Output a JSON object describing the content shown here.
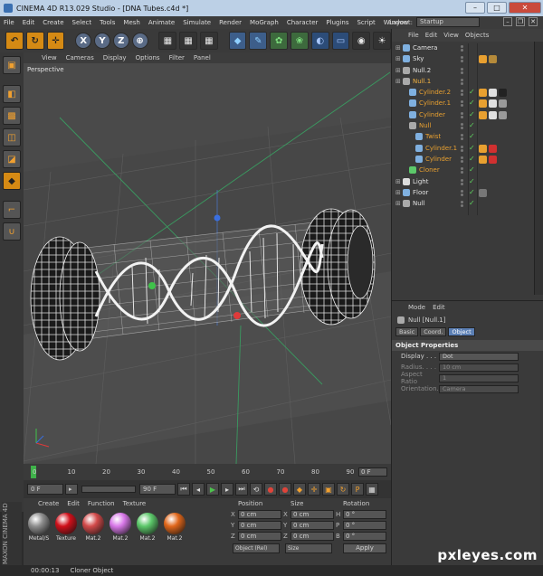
{
  "window": {
    "title": "CINEMA 4D R13.029 Studio - [DNA Tubes.c4d *]"
  },
  "menubar": [
    "File",
    "Edit",
    "Create",
    "Select",
    "Tools",
    "Mesh",
    "Animate",
    "Simulate",
    "Render",
    "MoGraph",
    "Character",
    "Plugins",
    "Script",
    "Window",
    "Help"
  ],
  "layout": {
    "label": "Layout:",
    "value": "Startup"
  },
  "viewport": {
    "menu": [
      "View",
      "Cameras",
      "Display",
      "Options",
      "Filter",
      "Panel"
    ],
    "label": "Perspective"
  },
  "timeline": {
    "ticks": [
      "0",
      "10",
      "20",
      "30",
      "40",
      "50",
      "60",
      "70",
      "80",
      "90"
    ],
    "frame_field": "0 F"
  },
  "transport": {
    "start": "0 F",
    "end": "90 F"
  },
  "materials": {
    "menu": [
      "Create",
      "Edit",
      "Function",
      "Texture"
    ],
    "items": [
      {
        "name": "Metal/S",
        "color": "#8e8e8e"
      },
      {
        "name": "Texture",
        "color": "#d0101a"
      },
      {
        "name": "Mat.2",
        "color": "#d24a4a"
      },
      {
        "name": "Mat.2",
        "color": "#d878e8"
      },
      {
        "name": "Mat.2",
        "color": "#5cc86a"
      },
      {
        "name": "Mat.2",
        "color": "#e0661a"
      }
    ],
    "brand": "MAXON CINEMA 4D"
  },
  "coords": {
    "headers": [
      "Position",
      "Size",
      "Rotation"
    ],
    "rows": [
      {
        "p_axis": "X",
        "p_val": "0 cm",
        "s_axis": "X",
        "s_val": "0 cm",
        "r_axis": "H",
        "r_val": "0 °"
      },
      {
        "p_axis": "Y",
        "p_val": "0 cm",
        "s_axis": "Y",
        "s_val": "0 cm",
        "r_axis": "P",
        "r_val": "0 °"
      },
      {
        "p_axis": "Z",
        "p_val": "0 cm",
        "s_axis": "Z",
        "s_val": "0 cm",
        "r_axis": "B",
        "r_val": "0 °"
      }
    ],
    "mode": "Object (Rel)",
    "size_mode": "Size",
    "apply": "Apply"
  },
  "status": {
    "time": "00:00:13",
    "message": "Cloner Object"
  },
  "object_manager": {
    "menu": [
      "File",
      "Edit",
      "View",
      "Objects"
    ],
    "items": [
      {
        "name": "Camera",
        "indent": 0,
        "color": "#e0e0e0",
        "icon": "#7fb0e0"
      },
      {
        "name": "Sky",
        "indent": 0,
        "color": "#e0e0e0",
        "icon": "#7fb0e0"
      },
      {
        "name": "Null.2",
        "indent": 0,
        "color": "#e0e0e0",
        "icon": "#aaa"
      },
      {
        "name": "Null.1",
        "indent": 0,
        "color": "#f0b040",
        "icon": "#aaa"
      },
      {
        "name": "Cylinder.2",
        "indent": 1,
        "color": "#e8a030",
        "icon": "#7fb0e0"
      },
      {
        "name": "Cylinder.1",
        "indent": 1,
        "color": "#e8a030",
        "icon": "#7fb0e0"
      },
      {
        "name": "Cylinder",
        "indent": 1,
        "color": "#e8a030",
        "icon": "#7fb0e0"
      },
      {
        "name": "Null",
        "indent": 1,
        "color": "#e8a030",
        "icon": "#aaa"
      },
      {
        "name": "Twist",
        "indent": 2,
        "color": "#e8a030",
        "icon": "#7fb0e0"
      },
      {
        "name": "Cylinder.1",
        "indent": 2,
        "color": "#e8a030",
        "icon": "#7fb0e0"
      },
      {
        "name": "Cylinder",
        "indent": 2,
        "color": "#e8a030",
        "icon": "#7fb0e0"
      },
      {
        "name": "Cloner",
        "indent": 1,
        "color": "#e8a030",
        "icon": "#5cc86a"
      },
      {
        "name": "Light",
        "indent": 0,
        "color": "#e0e0e0",
        "icon": "#ddd"
      },
      {
        "name": "Floor",
        "indent": 0,
        "color": "#e0e0e0",
        "icon": "#7fb0e0"
      },
      {
        "name": "Null",
        "indent": 0,
        "color": "#e0e0e0",
        "icon": "#aaa"
      }
    ]
  },
  "attributes": {
    "menu": [
      "Mode",
      "Edit"
    ],
    "object_label": "Null [Null.1]",
    "tabs": [
      "Basic",
      "Coord.",
      "Object"
    ],
    "active_tab": "Object",
    "section": "Object Properties",
    "fields": [
      {
        "label": "Display . . .",
        "value": "Dot",
        "disabled": false
      },
      {
        "label": "Radius. . . .",
        "value": "10 cm",
        "disabled": true
      },
      {
        "label": "Aspect Ratio",
        "value": "1",
        "disabled": true
      },
      {
        "label": "Orientation.",
        "value": "Camera",
        "disabled": true
      }
    ]
  },
  "watermark": "pxleyes.com"
}
